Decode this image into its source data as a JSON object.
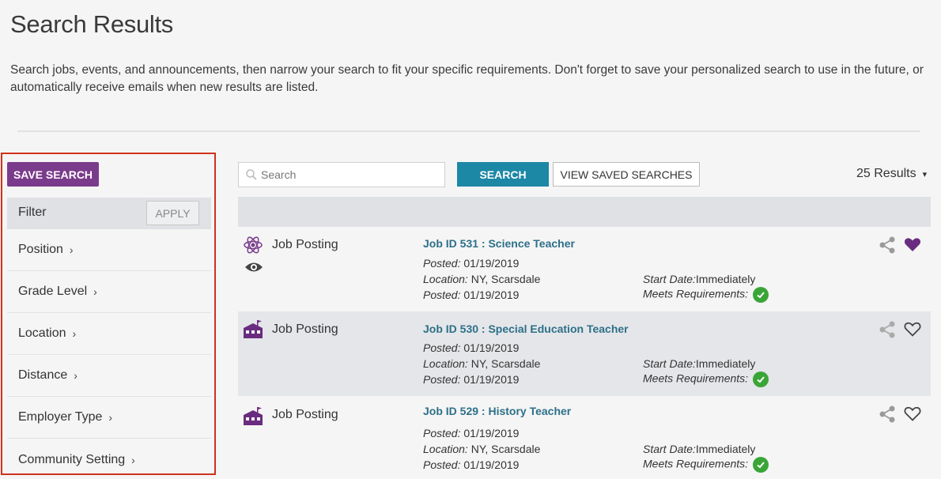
{
  "page": {
    "title": "Search Results",
    "intro": "Search jobs, events, and announcements, then narrow your search to fit your specific requirements. Don't forget to save your personalized search to use in the future, or automatically receive emails when new results are listed."
  },
  "sidebar": {
    "save_label": "SAVE SEARCH",
    "filter_label": "Filter",
    "apply_label": "APPLY",
    "filters": [
      {
        "label": "Position"
      },
      {
        "label": "Grade Level"
      },
      {
        "label": "Location"
      },
      {
        "label": "Distance"
      },
      {
        "label": "Employer Type"
      },
      {
        "label": "Community Setting"
      }
    ]
  },
  "toolbar": {
    "search_placeholder": "Search",
    "search_button": "SEARCH",
    "saved_button": "VIEW SAVED SEARCHES",
    "results_count": "25 Results"
  },
  "results": [
    {
      "type": "Job Posting",
      "type_icon": "atom-icon",
      "viewed": true,
      "title": "Job ID 531 : Science Teacher",
      "posted_label": "Posted:",
      "posted": "01/19/2019",
      "location_label": "Location:",
      "location": "NY, Scarsdale",
      "posted2_label": "Posted:",
      "posted2": "01/19/2019",
      "start_label": "Start Date:",
      "start": "Immediately",
      "meets_label": "Meets Requirements:",
      "favorited": true
    },
    {
      "type": "Job Posting",
      "type_icon": "school-building-icon",
      "viewed": false,
      "title": "Job ID 530 : Special Education Teacher",
      "posted_label": "Posted:",
      "posted": "01/19/2019",
      "location_label": "Location:",
      "location": "NY, Scarsdale",
      "posted2_label": "Posted:",
      "posted2": "01/19/2019",
      "start_label": "Start Date:",
      "start": "Immediately",
      "meets_label": "Meets Requirements:",
      "favorited": false
    },
    {
      "type": "Job Posting",
      "type_icon": "school-building-icon",
      "viewed": false,
      "title": "Job ID 529 : History Teacher",
      "posted_label": "Posted:",
      "posted": "01/19/2019",
      "location_label": "Location:",
      "location": "NY, Scarsdale",
      "posted2_label": "Posted:",
      "posted2": "01/19/2019",
      "start_label": "Start Date:",
      "start": "Immediately",
      "meets_label": "Meets Requirements:",
      "favorited": false
    }
  ],
  "colors": {
    "brand_purple": "#7b3b8c",
    "search_blue": "#1d87a6",
    "link_teal": "#2d7089",
    "check_green": "#3aa537",
    "highlight_red": "#d0321b"
  }
}
